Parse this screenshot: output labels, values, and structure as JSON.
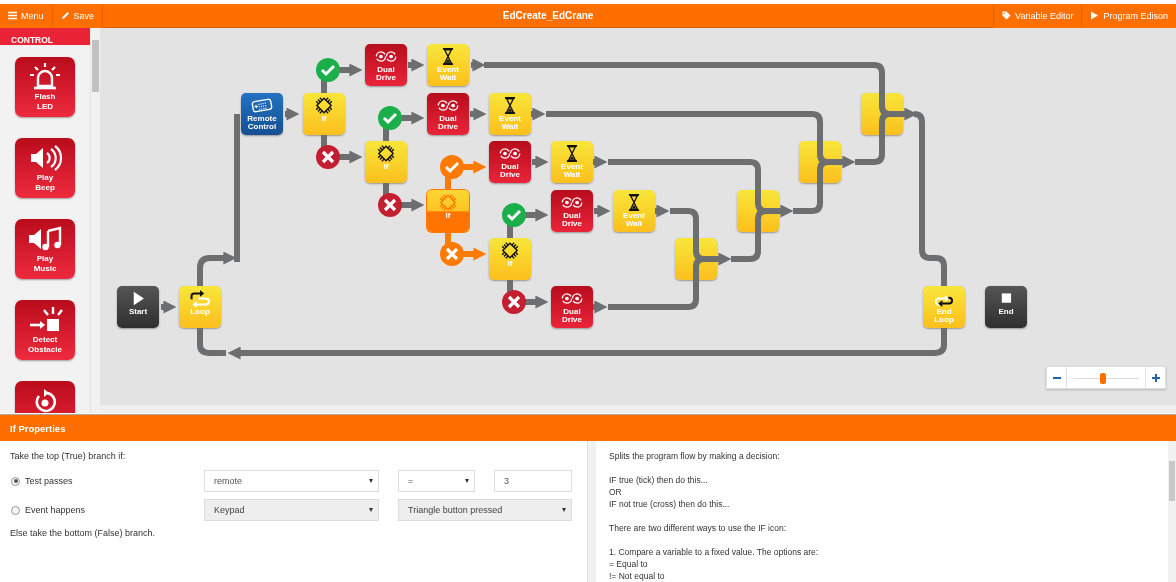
{
  "toolbar": {
    "left_buttons": [
      {
        "label": "Menu",
        "kind": "menu"
      },
      {
        "label": "Save",
        "kind": "save"
      }
    ],
    "title": "EdCreate_EdCrane",
    "right_buttons": [
      {
        "label": "Variable Editor",
        "kind": "tag"
      },
      {
        "label": "Program Edison",
        "kind": "play"
      }
    ]
  },
  "palette": {
    "category": "CONTROL",
    "items": [
      {
        "label": "Flash LED",
        "kind": "led"
      },
      {
        "label": "Play Beep",
        "kind": "beep"
      },
      {
        "label": "Play Music",
        "kind": "music"
      },
      {
        "label": "Detect Obstacle",
        "kind": "obstacle"
      },
      {
        "kind": "rotate"
      }
    ]
  },
  "program": {
    "blocks": [
      {
        "label": "Start",
        "kind": "start",
        "selected": false
      },
      {
        "label": "Loop",
        "kind": "loop",
        "selected": false
      },
      {
        "label": "Remote Control",
        "kind": "remote",
        "selected": false
      },
      {
        "label": "If",
        "kind": "if",
        "selected": false
      },
      {
        "label": "Dual Drive",
        "kind": "drive",
        "selected": false
      },
      {
        "label": "Event Wait",
        "kind": "wait",
        "selected": false
      },
      {
        "label": "If",
        "kind": "if",
        "selected": false
      },
      {
        "label": "Dual Drive",
        "kind": "drive",
        "selected": false
      },
      {
        "label": "Event Wait",
        "kind": "wait",
        "selected": false
      },
      {
        "label": "If",
        "kind": "if",
        "selected": true
      },
      {
        "label": "Dual Drive",
        "kind": "drive",
        "selected": false
      },
      {
        "label": "Event Wait",
        "kind": "wait",
        "selected": false
      },
      {
        "label": "If",
        "kind": "if",
        "selected": false
      },
      {
        "label": "Dual Drive",
        "kind": "drive",
        "selected": false
      },
      {
        "label": "Event Wait",
        "kind": "wait",
        "selected": false
      },
      {
        "label": "Dual Drive",
        "kind": "drive",
        "selected": false
      },
      {
        "kind": "merge",
        "selected": false
      },
      {
        "kind": "merge",
        "selected": false
      },
      {
        "kind": "merge",
        "selected": false
      },
      {
        "kind": "merge",
        "selected": false
      },
      {
        "label": "End Loop",
        "kind": "endloop",
        "selected": false
      },
      {
        "label": "End",
        "kind": "end",
        "selected": false
      }
    ],
    "zoom": {
      "level": 0.45
    }
  },
  "properties": {
    "title": "If Properties",
    "intro": "Take the top (True) branch if:",
    "options": [
      {
        "label": "Test passes",
        "selected": true,
        "fields": [
          {
            "kind": "select",
            "value": "remote",
            "disabled": false
          },
          {
            "kind": "select",
            "value": "=",
            "disabled": false
          },
          {
            "kind": "input",
            "value": "3",
            "disabled": false
          }
        ]
      },
      {
        "label": "Event happens",
        "selected": false,
        "fields": [
          {
            "kind": "select",
            "value": "Keypad",
            "disabled": true
          },
          {
            "kind": "select",
            "value": "Triangle button pressed",
            "disabled": true
          }
        ]
      }
    ],
    "outro": "Else take the bottom (False) branch."
  },
  "help": {
    "paragraphs": [
      [
        "Splits the program flow by making a decision:"
      ],
      [
        "IF true (tick) then do this...",
        "OR",
        "IF not true (cross) then do this..."
      ],
      [
        "There are two different ways to use the IF icon:"
      ],
      [
        "1. Compare a variable to a fixed value. The options are:",
        "= Equal to",
        "!= Not equal to"
      ]
    ]
  }
}
